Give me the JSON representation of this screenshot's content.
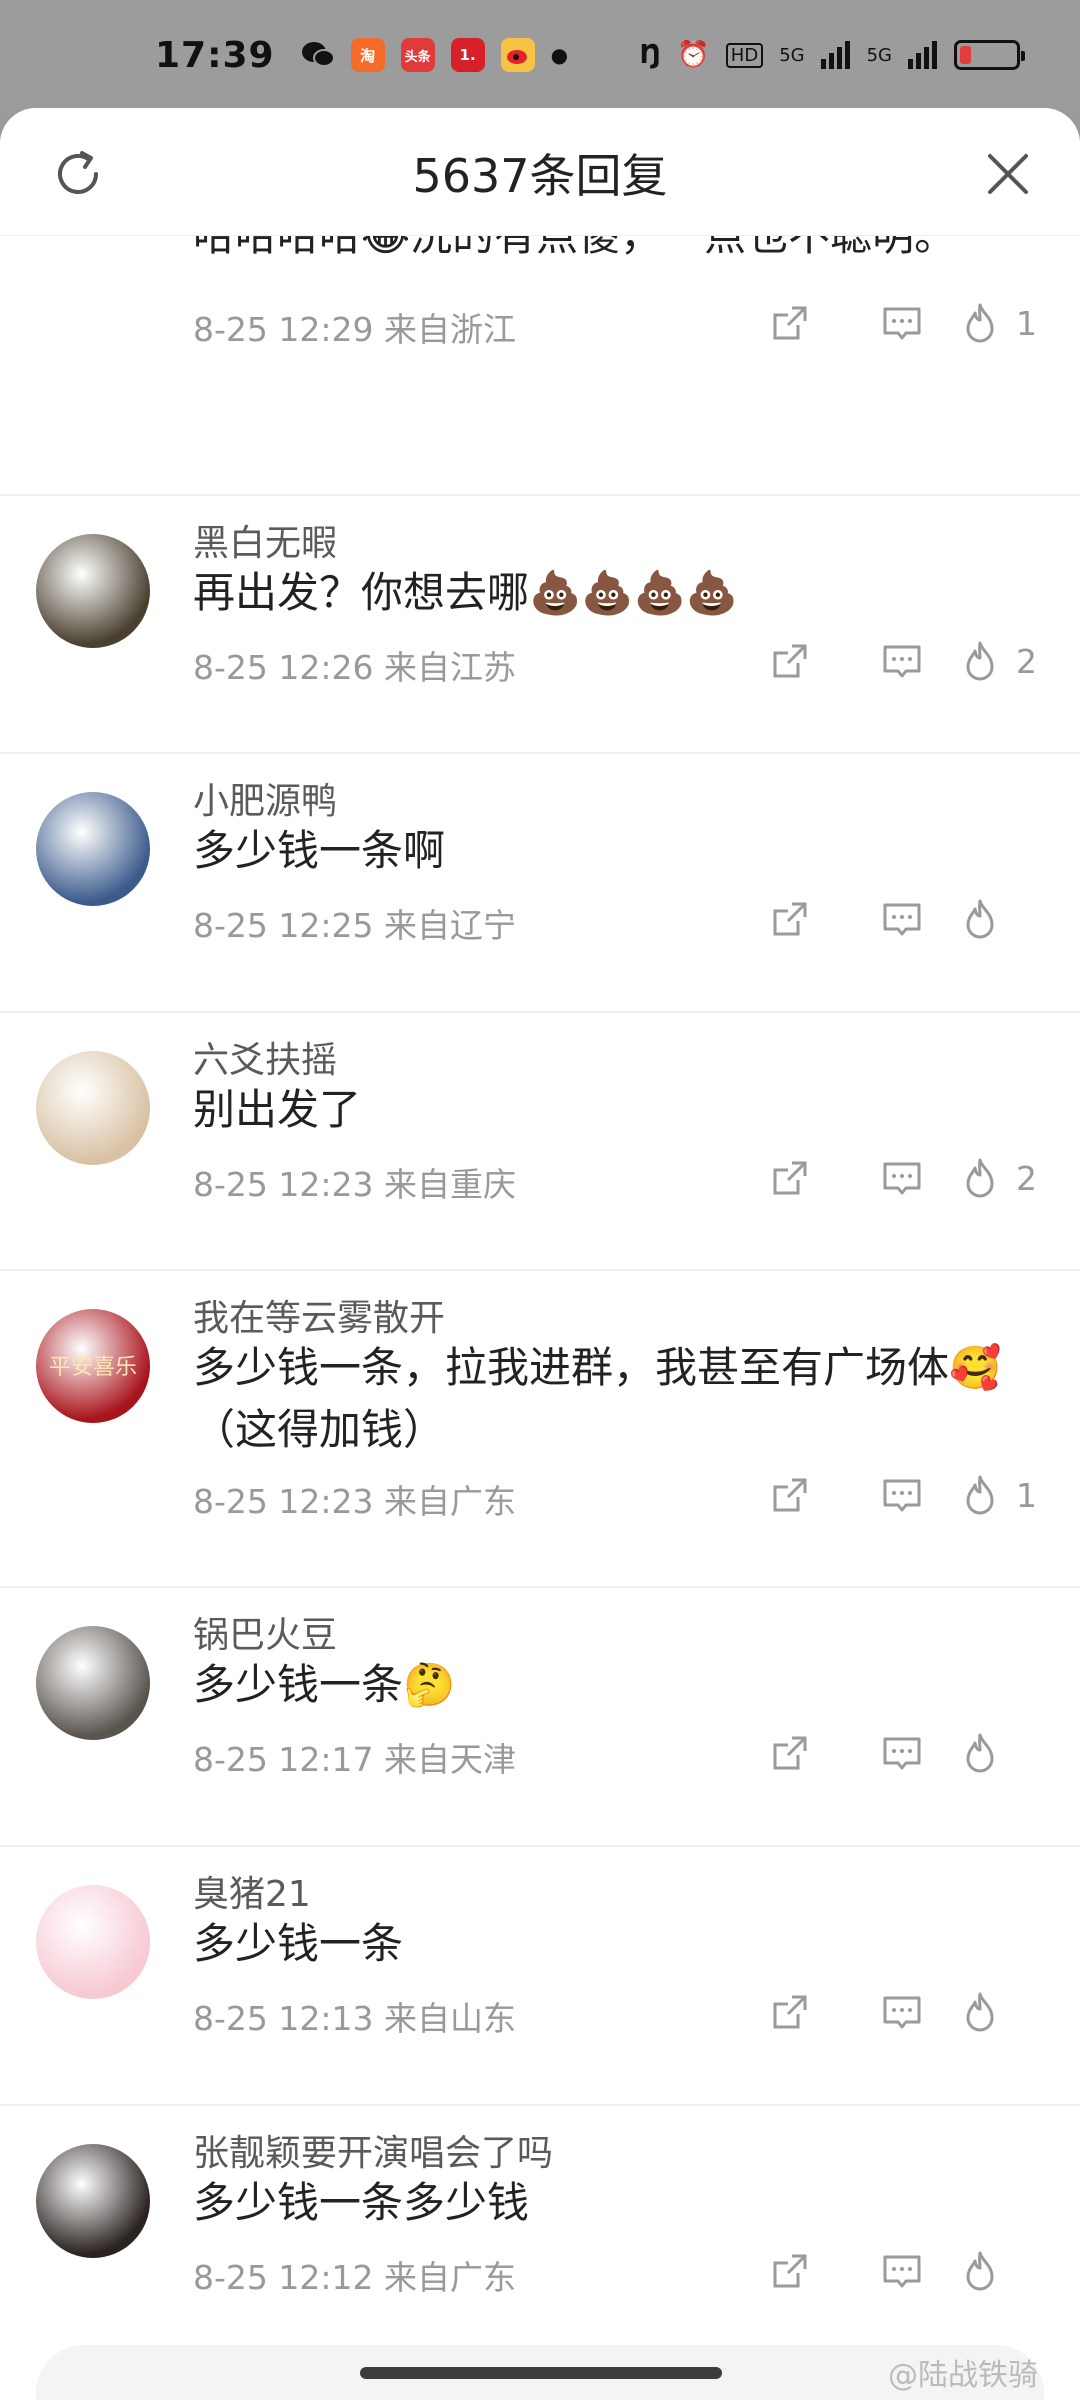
{
  "status_bar": {
    "time": "17:39",
    "apps": [
      {
        "name": "wechat-icon",
        "label": "",
        "color": "#111111"
      },
      {
        "name": "taobao-icon",
        "label": "",
        "color": "#f56b2a"
      },
      {
        "name": "toutiao-icon",
        "label": "头条",
        "color": "#e03a3a"
      },
      {
        "name": "app-1-icon",
        "label": "1.",
        "color": "#d8202a"
      },
      {
        "name": "weibo-icon",
        "label": "",
        "color": "#f6c445"
      }
    ],
    "network": "5G",
    "network2": "5G",
    "hd_label": "HD",
    "battery_level": 0.2
  },
  "header": {
    "title": "5637条回复"
  },
  "comments": [
    {
      "username": "",
      "text": "哈哈哈哈😂洗的有点傻，一点也不聪明。",
      "time": "8-25 12:29",
      "location": "来自浙江",
      "likes": "1",
      "avatar_color": "#f2d6dc"
    },
    {
      "username": "黑白无暇",
      "text": "再出发？你想去哪💩💩💩💩",
      "time": "8-25 12:26",
      "location": "来自江苏",
      "likes": "2",
      "avatar_color": "#4a4030"
    },
    {
      "username": "小肥源鸭",
      "text": "多少钱一条啊",
      "time": "8-25 12:25",
      "location": "来自辽宁",
      "likes": "",
      "avatar_color": "#3b5b8c"
    },
    {
      "username": "六爻扶摇",
      "text": "别出发了",
      "time": "8-25 12:23",
      "location": "来自重庆",
      "likes": "2",
      "avatar_color": "#d9c2a4"
    },
    {
      "username": "我在等云雾散开",
      "text": "多少钱一条，拉我进群，我甚至有广场体🥰（这得加钱）",
      "time": "8-25 12:23",
      "location": "来自广东",
      "likes": "1",
      "avatar_color": "#a8141c",
      "avatar_text": "平安喜乐"
    },
    {
      "username": "锅巴火豆",
      "text": "多少钱一条🤔",
      "time": "8-25 12:17",
      "location": "来自天津",
      "likes": "",
      "avatar_color": "#5a544f"
    },
    {
      "username": "臭猪21",
      "text": "多少钱一条",
      "time": "8-25 12:13",
      "location": "来自山东",
      "likes": "",
      "avatar_color": "#f7c9d3"
    },
    {
      "username": "张靓颖要开演唱会了吗",
      "text": "多少钱一条多少钱",
      "time": "8-25 12:12",
      "location": "来自广东",
      "likes": "",
      "avatar_color": "#2a2320"
    }
  ],
  "input": {
    "placeholder": ""
  },
  "watermark": "@陆战铁骑"
}
